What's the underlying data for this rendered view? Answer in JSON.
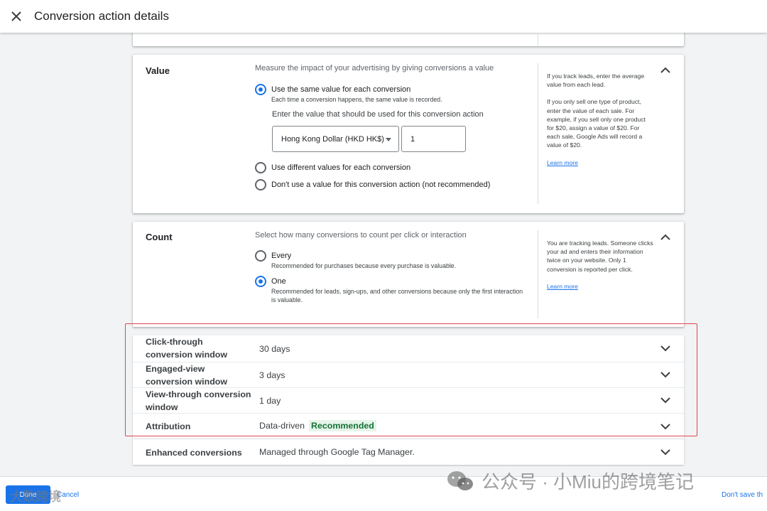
{
  "header": {
    "title": "Conversion action details",
    "close_icon": "close-icon"
  },
  "value_section": {
    "title": "Value",
    "description": "Measure the impact of your advertising by giving conversions a value",
    "options": [
      {
        "label": "Use the same value for each conversion",
        "sublabel": "Each time a conversion happens, the same value is recorded.",
        "checked": true
      },
      {
        "label": "Use different values for each conversion",
        "checked": false
      },
      {
        "label": "Don't use a value for this conversion action (not recommended)",
        "checked": false
      }
    ],
    "value_prompt": "Enter the value that should be used for this conversion action",
    "currency": "Hong Kong Dollar (HKD HK$)",
    "value": "1",
    "help_1": "If you track leads, enter the average value from each lead.",
    "help_2": "If you only sell one type of product, enter the value of each sale. For example, if you sell only one product for $20, assign a value of $20. For each sale, Google Ads will record a value of $20.",
    "learn_more": "Learn more"
  },
  "count_section": {
    "title": "Count",
    "description": "Select how many conversions to count per click or interaction",
    "options": [
      {
        "label": "Every",
        "sublabel": "Recommended for purchases because every purchase is valuable.",
        "checked": false
      },
      {
        "label": "One",
        "sublabel": "Recommended for leads, sign-ups, and other conversions because only the first interaction is valuable.",
        "checked": true
      }
    ],
    "help": "You are tracking leads. Someone clicks your ad and enters their information twice on your website. Only 1 conversion is reported per click.",
    "learn_more": "Learn more"
  },
  "settings_rows": [
    {
      "title": "Click-through conversion window",
      "value": "30 days"
    },
    {
      "title": "Engaged-view conversion window",
      "value": "3 days"
    },
    {
      "title": "View-through conversion window",
      "value": "1 day"
    },
    {
      "title": "Attribution",
      "value": "Data-driven",
      "badge": "Recommended"
    },
    {
      "title": "Enhanced conversions",
      "value": "Managed through Google Tag Manager."
    }
  ],
  "footer": {
    "done": "Done",
    "cancel": "Cancel",
    "dont_save": "Don't save th"
  },
  "watermark": {
    "text": "公众号 · 小Miu的跨境笔记",
    "bottom_text": "大数跨境"
  },
  "colors": {
    "accent": "#1a73e8",
    "highlight": "#e0464c",
    "recommended_bg": "#e6f4ea",
    "recommended_text": "#137333"
  }
}
